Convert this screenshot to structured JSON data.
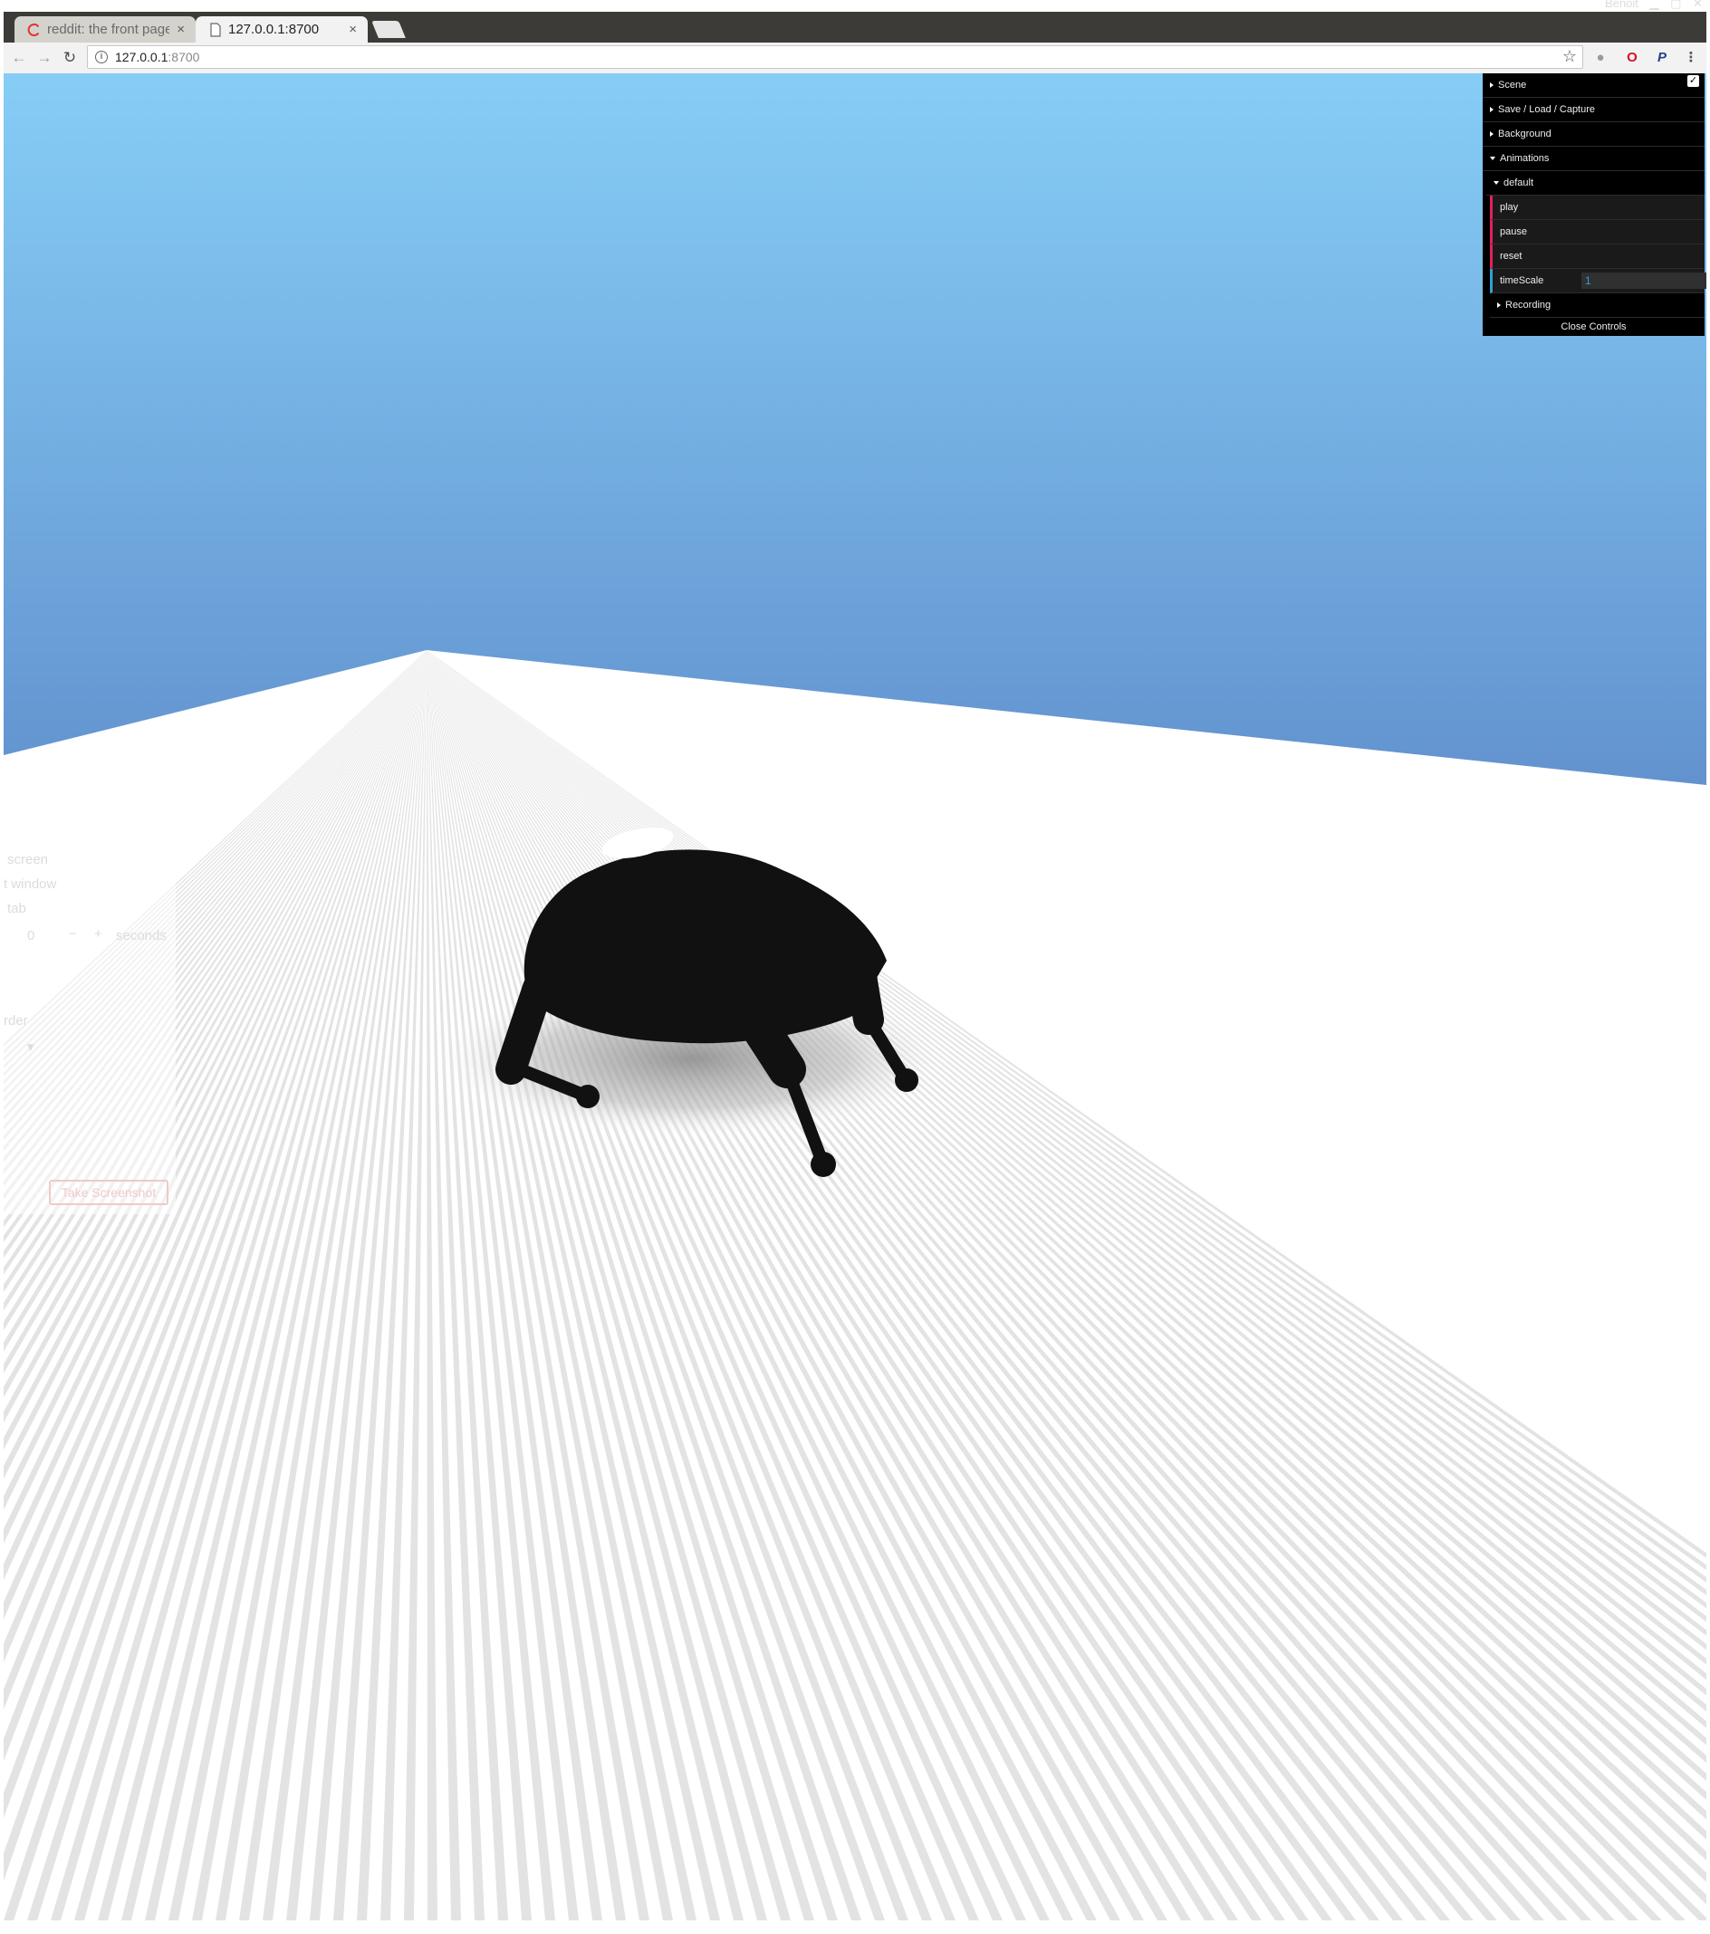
{
  "browser": {
    "window_user": "Benoit",
    "tabs": [
      {
        "title": "reddit: the front page",
        "close": "×"
      },
      {
        "title": "127.0.0.1:8700",
        "close": "×"
      }
    ],
    "url_host": "127.0.0.1",
    "url_port": ":8700",
    "icons": [
      "back-icon",
      "forward-icon",
      "reload-icon",
      "info-icon",
      "star-icon",
      "shield-icon",
      "opera-icon",
      "paypal-icon",
      "menu-icon"
    ]
  },
  "gui": {
    "folders": {
      "scene": "Scene",
      "save_load": "Save / Load / Capture",
      "background": "Background",
      "animations": "Animations",
      "default": "default",
      "recording": "Recording"
    },
    "buttons": {
      "play": "play",
      "pause": "pause",
      "reset": "reset"
    },
    "timescale": {
      "label": "timeScale",
      "value": "1"
    },
    "close": "Close Controls",
    "scene_checked": true,
    "colors": {
      "function_accent": "#e61d5f",
      "number_accent": "#2fa1d6"
    }
  },
  "ghost_panel": {
    "screen": "screen",
    "window": "t window",
    "tab": "tab",
    "delay_value": "0",
    "seconds": "seconds",
    "border": "rder",
    "take_screenshot": "Take Screenshot"
  },
  "scene_colors": {
    "sky_top": "#86cdf6",
    "sky_bottom": "#5d8ac9",
    "floor": "#ffffff",
    "stripe": "#d9d9d9",
    "robot": "#111111"
  }
}
